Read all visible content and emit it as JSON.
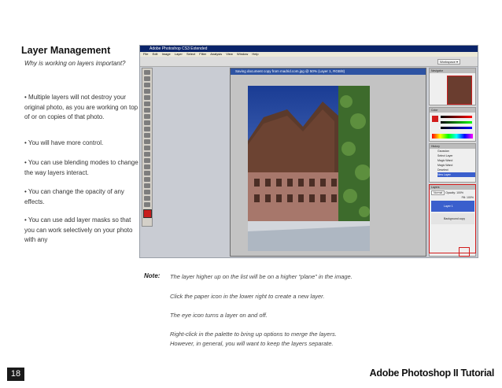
{
  "heading": "Layer Management",
  "intro": {
    "question": "Why is working on layers important?"
  },
  "bullets": [
    "• Multiple layers will not destroy your original photo, as you are working on top of or on copies of that photo.",
    "• You will have more control.",
    "• You can use blending modes to change the way layers interact.",
    "• You can change the opacity of any effects.",
    "• You can use add layer masks so that you can work selectively on your photo with any"
  ],
  "screenshot": {
    "app_title": "Adobe Photoshop CS3 Extended",
    "menu": [
      "File",
      "Edit",
      "Image",
      "Layer",
      "Select",
      "Filter",
      "Analysis",
      "View",
      "Window",
      "Help"
    ],
    "doc_title": "Saving document copy from madrid.com.jpg @ 50% (Layer 1, RGB/8)",
    "workspace_label": "Workspace ▾",
    "panels": {
      "navigator_tab": "Navigator",
      "color_tab": "Color",
      "history_tab": "History",
      "layers_tab": "Layers",
      "history_items": [
        "Gaussian",
        "Select Layer",
        "Magic Wand",
        "Magic Wand",
        "Deselect",
        "New Layer"
      ],
      "layers": [
        "Layer 1",
        "Background copy"
      ],
      "blend_mode": "Normal",
      "opacity": "Opacity: 100%",
      "fill": "Fill: 100%"
    },
    "colors": {
      "highlight": "#d21c1c",
      "title_bar": "#0a246a",
      "layer_selected": "#3a5fcd"
    }
  },
  "notes": {
    "label": "Note:",
    "lines": [
      "The layer higher up on the list will be on a higher “plane” in the image.",
      "Click the paper icon in the lower right to create a new layer.",
      "The eye icon turns a layer on and off.",
      "Right-click in the palette to bring up options to merge the layers.",
      "However, in general, you will want to keep the layers separate."
    ]
  },
  "footer": {
    "page_number": "18",
    "brand": "Adobe Photoshop II Tutorial"
  }
}
